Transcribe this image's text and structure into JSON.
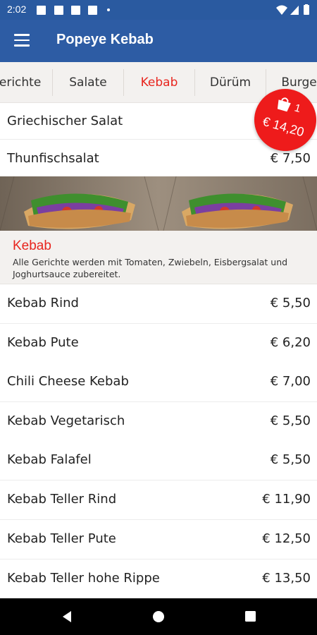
{
  "status_bar": {
    "time": "2:02"
  },
  "app_bar": {
    "title": "Popeye Kebab",
    "menu_icon": "hamburger-menu-icon"
  },
  "tabs": [
    {
      "label": "Gerichte",
      "active": false
    },
    {
      "label": "Salate",
      "active": false
    },
    {
      "label": "Kebab",
      "active": true
    },
    {
      "label": "Dürüm",
      "active": false
    },
    {
      "label": "Burger",
      "active": false
    }
  ],
  "salad_items": [
    {
      "name": "Griechischer Salat",
      "price": ""
    },
    {
      "name": "Thunfischsalat",
      "price": "€ 7,50"
    }
  ],
  "category": {
    "title": "Kebab",
    "description": "Alle Gerichte werden mit Tomaten, Zwiebeln, Eisbergsalat und Joghurtsauce zubereitet."
  },
  "kebab_items": [
    {
      "name": "Kebab Rind",
      "price": "€ 5,50"
    },
    {
      "name": "Kebab Pute",
      "price": "€ 6,20"
    },
    {
      "name": "Chili Cheese Kebab",
      "price": "€ 7,00"
    },
    {
      "name": "Kebab Vegetarisch",
      "price": "€ 5,50"
    },
    {
      "name": "Kebab Falafel",
      "price": "€ 5,50"
    },
    {
      "name": "Kebab Teller Rind",
      "price": "€ 11,90"
    },
    {
      "name": "Kebab Teller Pute",
      "price": "€ 12,50"
    },
    {
      "name": "Kebab Teller hohe Rippe",
      "price": "€ 13,50"
    }
  ],
  "cart": {
    "count": "1",
    "total": "€ 14,20",
    "icon": "shopping-bag-icon"
  },
  "colors": {
    "primary": "#2d5ca4",
    "status_bar": "#2a5aa0",
    "accent": "#e8251e",
    "badge": "#ee1b1b",
    "tab_bg": "#f3f1ef"
  }
}
